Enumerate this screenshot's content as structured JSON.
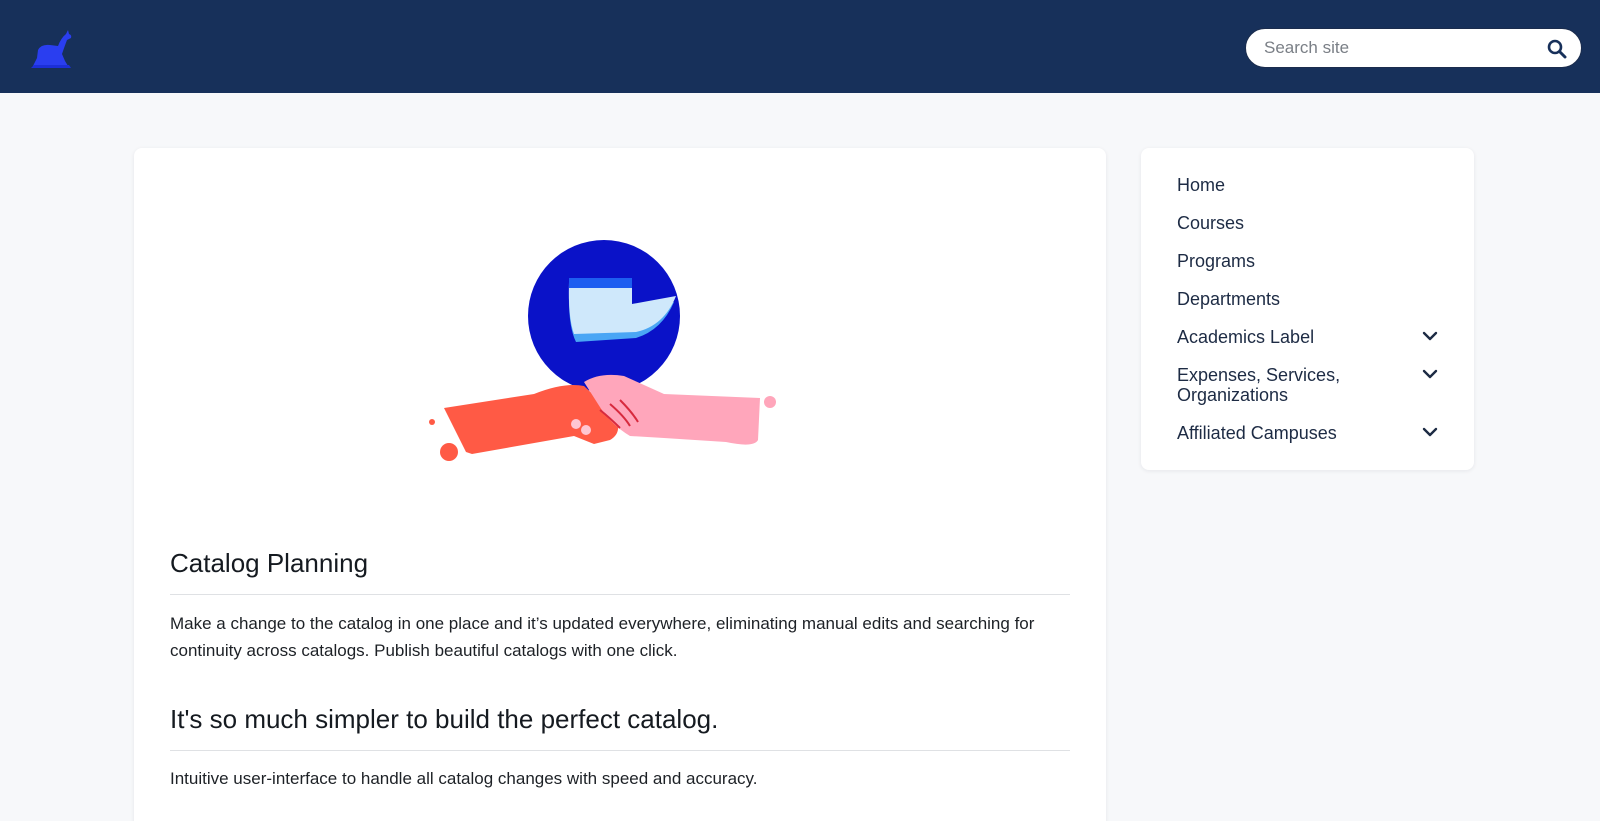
{
  "header": {
    "logo_icon": "greyhound-logo-icon",
    "search": {
      "placeholder": "Search site",
      "icon": "search-icon"
    }
  },
  "colors": {
    "header_bg": "#17305a",
    "page_bg": "#f7f8fa",
    "hero_circle": "#0a12c8",
    "hand_left": "#ff5a45",
    "hand_right": "#ffa6bb"
  },
  "main": {
    "sections": [
      {
        "heading": "Catalog Planning",
        "body": "Make a change to the catalog in one place and it’s updated everywhere, eliminating manual edits and searching for continuity across catalogs. Publish beautiful catalogs with one click."
      },
      {
        "heading": "It's so much simpler to build the perfect catalog.",
        "body": "Intuitive user-interface to handle all catalog changes with speed and accuracy."
      }
    ]
  },
  "sidebar": {
    "items": [
      {
        "label": "Home",
        "expandable": false
      },
      {
        "label": "Courses",
        "expandable": false
      },
      {
        "label": "Programs",
        "expandable": false
      },
      {
        "label": "Departments",
        "expandable": false
      },
      {
        "label": "Academics Label",
        "expandable": true
      },
      {
        "label": "Expenses, Services, Organizations",
        "expandable": true
      },
      {
        "label": "Affiliated Campuses",
        "expandable": true
      }
    ]
  }
}
